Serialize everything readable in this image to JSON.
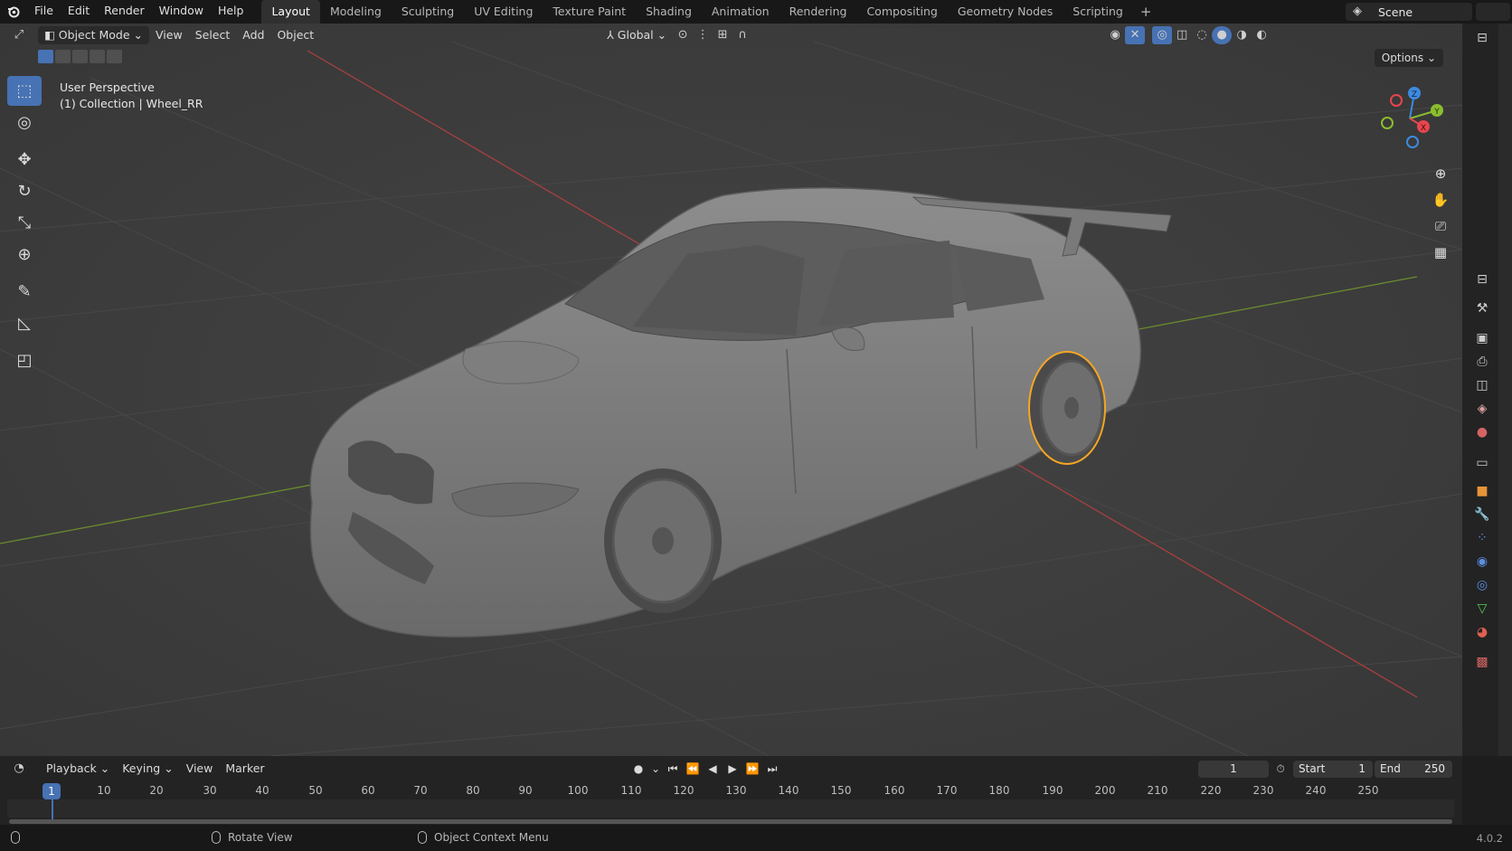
{
  "topbar": {
    "menus": [
      "File",
      "Edit",
      "Render",
      "Window",
      "Help"
    ],
    "workspaces": [
      "Layout",
      "Modeling",
      "Sculpting",
      "UV Editing",
      "Texture Paint",
      "Shading",
      "Animation",
      "Rendering",
      "Compositing",
      "Geometry Nodes",
      "Scripting"
    ],
    "active_workspace": "Layout",
    "add_workspace": "+",
    "scene": "Scene"
  },
  "viewport_header": {
    "mode": "Object Mode",
    "menus": [
      "View",
      "Select",
      "Add",
      "Object"
    ],
    "transform_orientation": "Global",
    "options": "Options"
  },
  "viewport": {
    "perspective_label": "User Perspective",
    "collection_label": "(1) Collection | Wheel_RR",
    "gizmo_axes": [
      "Z",
      "Y",
      "X"
    ],
    "axis_colors": {
      "x": "#e8454e",
      "y": "#8bbd2f",
      "z": "#3d8be0"
    },
    "selection_color": "#f5a623"
  },
  "toolbar": {
    "tools": [
      "select-box",
      "cursor",
      "move",
      "rotate",
      "scale",
      "transform",
      "annotate",
      "measure",
      "add-cube"
    ],
    "active": "select-box"
  },
  "timeline": {
    "menus": [
      "Playback",
      "Keying",
      "View",
      "Marker"
    ],
    "current_frame": "1",
    "start_label": "Start",
    "start": "1",
    "end_label": "End",
    "end": "250",
    "ruler": [
      "10",
      "20",
      "30",
      "40",
      "50",
      "60",
      "70",
      "80",
      "90",
      "100",
      "110",
      "120",
      "130",
      "140",
      "150",
      "160",
      "170",
      "180",
      "190",
      "200",
      "210",
      "220",
      "230",
      "240",
      "250"
    ],
    "playhead_label": "1"
  },
  "statusbar": {
    "left_hint": "Rotate View",
    "right_hint": "Object Context Menu",
    "version": "4.0.2"
  }
}
